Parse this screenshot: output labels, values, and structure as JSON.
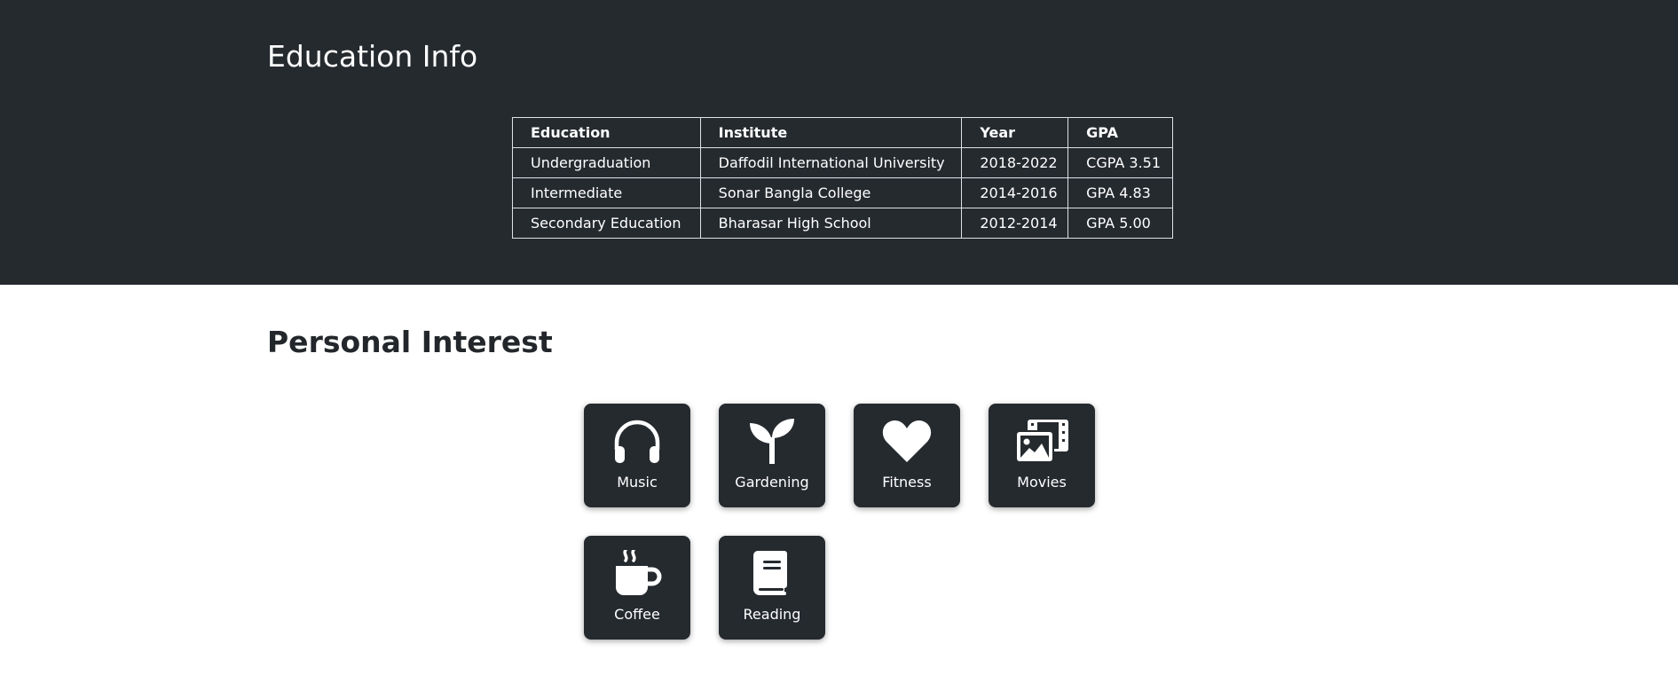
{
  "education": {
    "title": "Education Info",
    "headers": [
      "Education",
      "Institute",
      "Year",
      "GPA"
    ],
    "rows": [
      [
        "Undergraduation",
        "Daffodil International University",
        "2018-2022",
        "CGPA 3.51"
      ],
      [
        "Intermediate",
        "Sonar Bangla College",
        "2014-2016",
        "GPA 4.83"
      ],
      [
        "Secondary Education",
        "Bharasar High School",
        "2012-2014",
        "GPA 5.00"
      ]
    ]
  },
  "interests": {
    "title": "Personal Interest",
    "items": [
      {
        "label": "Music",
        "icon": "headphones-icon"
      },
      {
        "label": "Gardening",
        "icon": "seedling-icon"
      },
      {
        "label": "Fitness",
        "icon": "heart-icon"
      },
      {
        "label": "Movies",
        "icon": "photo-film-icon"
      },
      {
        "label": "Coffee",
        "icon": "mug-hot-icon"
      },
      {
        "label": "Reading",
        "icon": "book-icon"
      }
    ]
  },
  "colors": {
    "dark_background": "#252a2f",
    "text_light": "#ffffff",
    "text_dark": "#23272b"
  }
}
